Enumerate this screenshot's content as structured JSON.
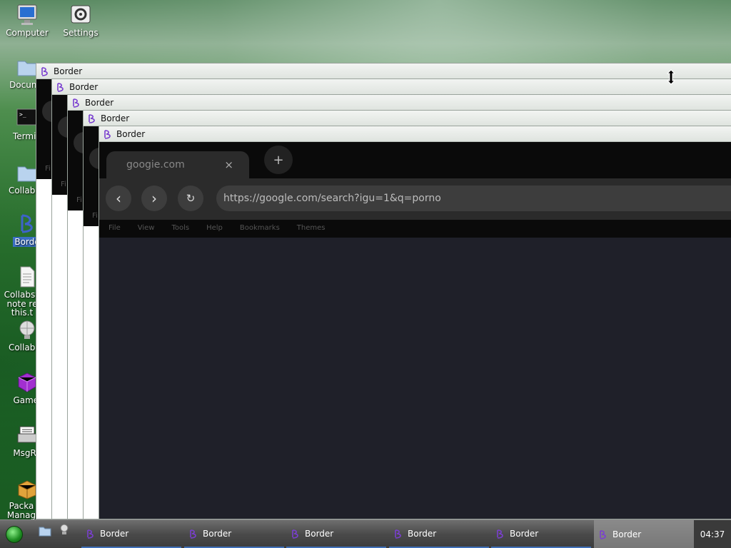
{
  "desktop": {
    "icons": [
      {
        "label": "Computer",
        "icon": "monitor-icon"
      },
      {
        "label": "Settings",
        "icon": "settings-icon"
      },
      {
        "label": "Docume",
        "icon": "folder-icon"
      },
      {
        "label": "Termin",
        "icon": "terminal-icon"
      },
      {
        "label": "CollabSy",
        "icon": "folder-icon"
      },
      {
        "label": "Borde",
        "icon": "border-browser-icon",
        "selected": true
      },
      {
        "label": "Collabsy note re this.t",
        "icon": "text-file-icon"
      },
      {
        "label": "CollabSy",
        "icon": "globe-icon"
      },
      {
        "label": "Gamei",
        "icon": "cube-icon"
      },
      {
        "label": "MsgRo",
        "icon": "printer-icon"
      },
      {
        "label": "Packa Manag",
        "icon": "package-icon"
      }
    ]
  },
  "windows": [
    {
      "title": "Border"
    },
    {
      "title": "Border"
    },
    {
      "title": "Border"
    },
    {
      "title": "Border"
    },
    {
      "title": "Border"
    }
  ],
  "browser": {
    "tab_title": "googie.com",
    "tab_close": "×",
    "new_tab": "+",
    "back": "‹",
    "forward": "›",
    "reload": "↻",
    "url": "https://google.com/search?igu=1&q=porno",
    "menu": [
      "File",
      "View",
      "Tools",
      "Help",
      "Bookmarks",
      "Themes"
    ]
  },
  "bg_windows_menu_stub": "Fi",
  "taskbar": {
    "items": [
      {
        "label": "Border",
        "active": false
      },
      {
        "label": "Border",
        "active": false
      },
      {
        "label": "Border",
        "active": false
      },
      {
        "label": "Border",
        "active": false
      },
      {
        "label": "Border",
        "active": false
      },
      {
        "label": "Border",
        "active": true
      }
    ],
    "clock": "04:37"
  },
  "colors": {
    "accent": "#3f6fb8",
    "border_logo": "#7a3fd0",
    "browser_bg": "#1f2029"
  }
}
